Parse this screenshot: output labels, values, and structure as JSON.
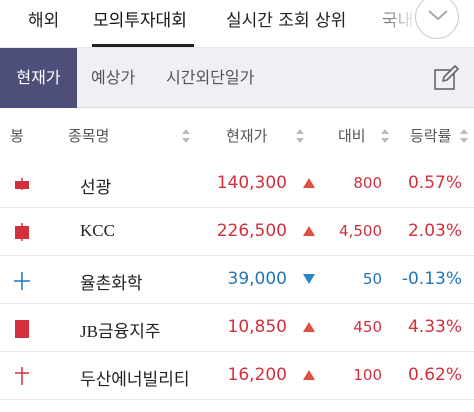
{
  "top_tabs": [
    "해외",
    "모의투자대회",
    "실시간 조회 상위",
    "국내"
  ],
  "sub_tabs": [
    "현재가",
    "예상가",
    "시간외단일가"
  ],
  "table_header": {
    "candle": "봉",
    "name": "종목명",
    "price": "현재가",
    "change": "대비",
    "rate": "등락률"
  },
  "rows": [
    {
      "name": "선광",
      "price": "140,300",
      "direction": "up",
      "change": "800",
      "rate": "0.57%"
    },
    {
      "name": "KCC",
      "price": "226,500",
      "direction": "up",
      "change": "4,500",
      "rate": "2.03%"
    },
    {
      "name": "율촌화학",
      "price": "39,000",
      "direction": "down",
      "change": "50",
      "rate": "-0.13%"
    },
    {
      "name": "JB금융지주",
      "price": "10,850",
      "direction": "up",
      "change": "450",
      "rate": "4.33%"
    },
    {
      "name": "두산에너빌리티",
      "price": "16,200",
      "direction": "up",
      "change": "100",
      "rate": "0.62%"
    }
  ],
  "colors": {
    "up": "#d2303c",
    "down": "#2276b8",
    "active_sub_tab": "#4e4e7a"
  },
  "icons": {
    "expand": "chevron-down-icon",
    "edit": "edit-icon",
    "sort": "sort-arrows-icon"
  }
}
